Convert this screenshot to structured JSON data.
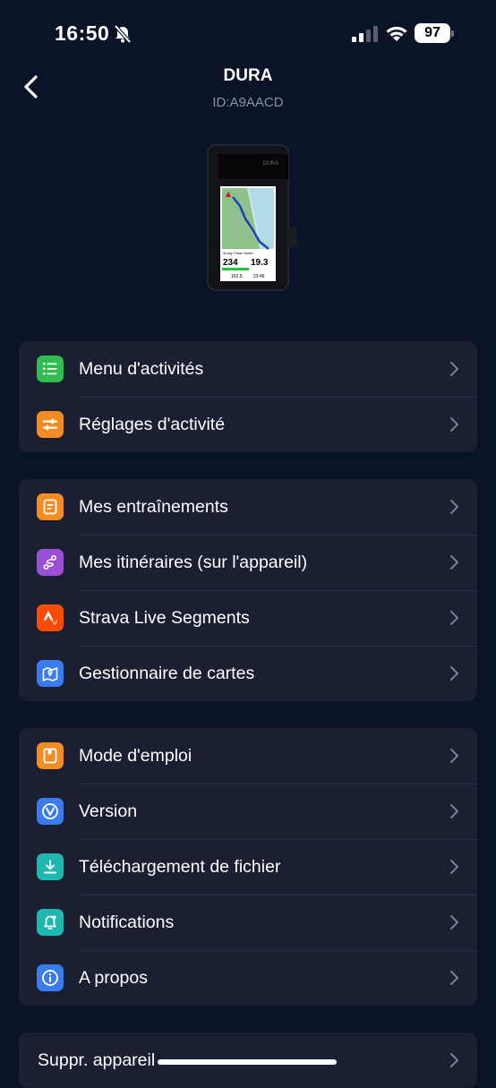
{
  "status_bar": {
    "time": "16:50",
    "battery": "97"
  },
  "header": {
    "title": "DURA",
    "device_id": "ID:A9AACD"
  },
  "device_screen": {
    "metric_labels": "3s Avg. Power  Speed",
    "power": "234",
    "speed": "19.3",
    "bottom_left": "152.5",
    "bottom_right": "23:46"
  },
  "groups": [
    {
      "items": [
        {
          "label": "Menu d'activités",
          "icon": "list-icon",
          "color": "#2ebd4e"
        },
        {
          "label": "Réglages d'activité",
          "icon": "sliders-icon",
          "color": "#f58b23"
        }
      ]
    },
    {
      "items": [
        {
          "label": "Mes entraînements",
          "icon": "workout-icon",
          "color": "#f58b23"
        },
        {
          "label": "Mes itinéraires (sur l'appareil)",
          "icon": "route-icon",
          "color": "#9b4fd6"
        },
        {
          "label": "Strava Live Segments",
          "icon": "strava-icon",
          "color": "#fc4c02"
        },
        {
          "label": "Gestionnaire de cartes",
          "icon": "map-icon",
          "color": "#3a7bf0"
        }
      ]
    },
    {
      "items": [
        {
          "label": "Mode d'emploi",
          "icon": "manual-icon",
          "color": "#f58b23"
        },
        {
          "label": "Version",
          "icon": "version-icon",
          "color": "#3a7bf0"
        },
        {
          "label": "Téléchargement de fichier",
          "icon": "download-icon",
          "color": "#1fb8b0"
        },
        {
          "label": "Notifications",
          "icon": "bell-icon",
          "color": "#1fb8b0"
        },
        {
          "label": "A propos",
          "icon": "info-icon",
          "color": "#3a7bf0"
        }
      ]
    },
    {
      "items": [
        {
          "label": "Suppr. appareil"
        }
      ]
    }
  ]
}
